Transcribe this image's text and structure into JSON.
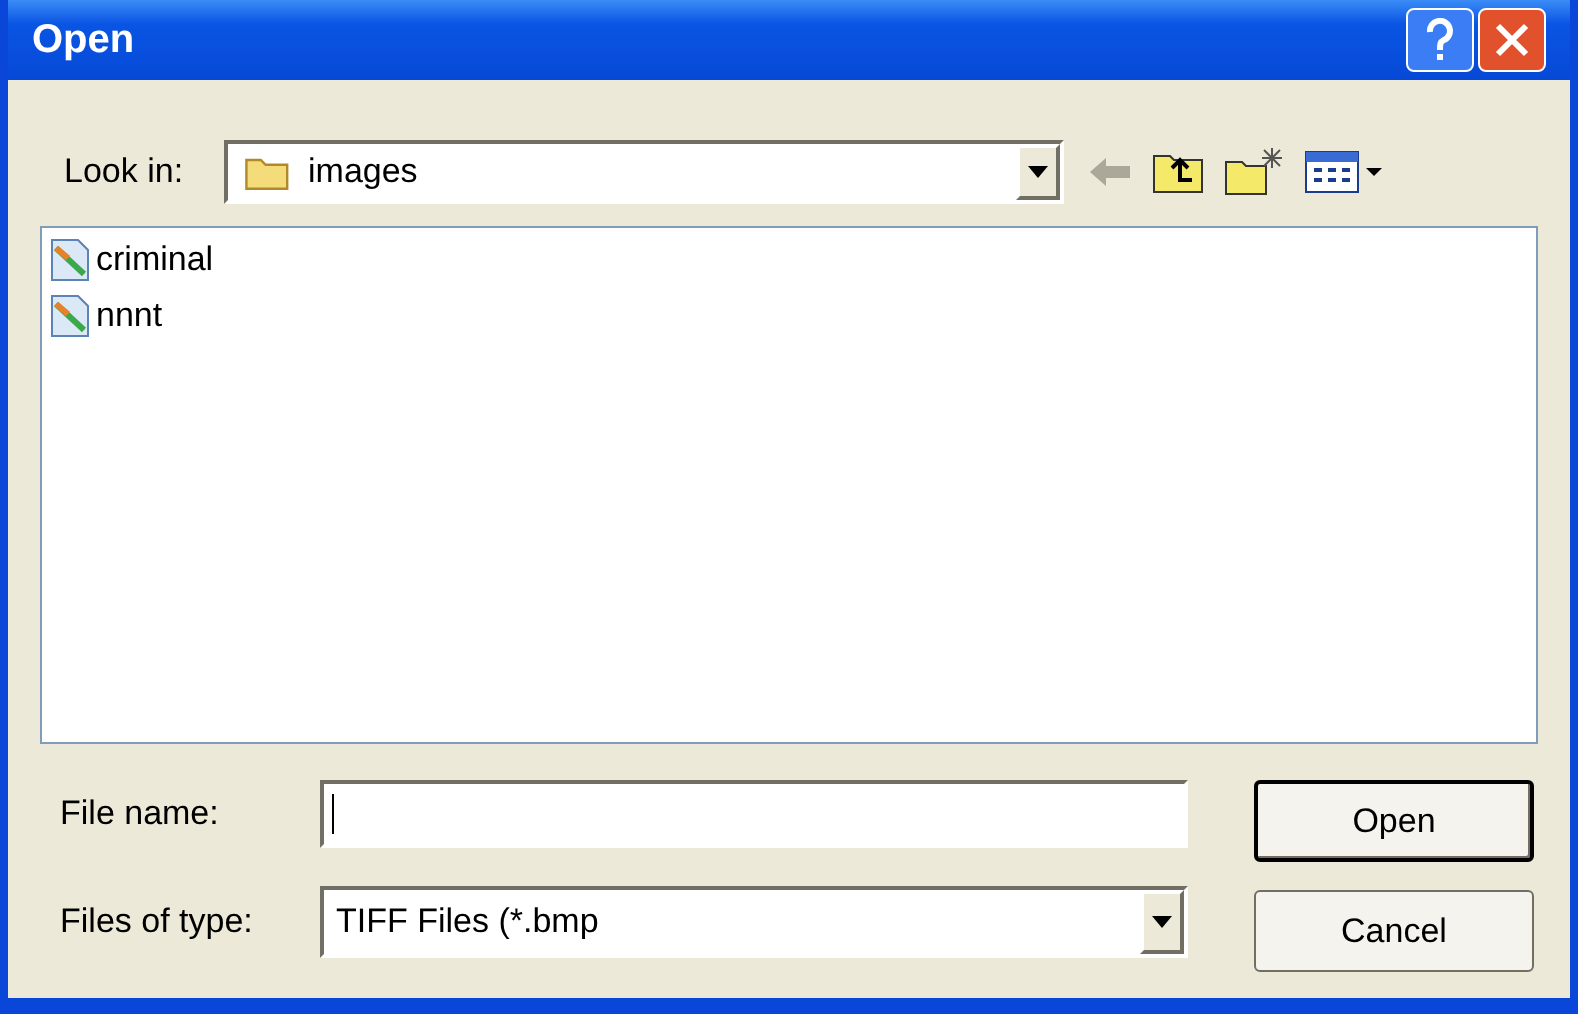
{
  "window": {
    "title": "Open"
  },
  "look_in": {
    "label": "Look in:",
    "value": "images"
  },
  "files": [
    {
      "name": "criminal",
      "selected": false
    },
    {
      "name": "nnnt",
      "selected": false
    }
  ],
  "file_name": {
    "label": "File name:"
  },
  "file_type": {
    "label": "Files of type:",
    "value": "TIFF Files (*.bmp"
  },
  "buttons": [
    {
      "label": "Open",
      "kind": "default"
    },
    {
      "label": "Cancel",
      "kind": "normal"
    }
  ]
}
